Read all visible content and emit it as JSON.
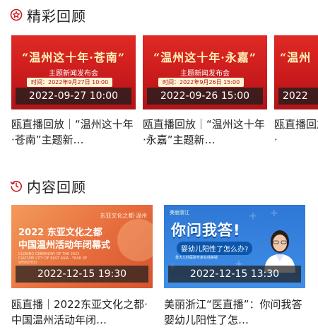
{
  "sections": {
    "highlights": {
      "title": "精彩回顾",
      "icon": "star-circle-icon"
    },
    "content": {
      "title": "内容回顾",
      "icon": "history-clock-icon"
    }
  },
  "highlights": [
    {
      "thumb_title": "“温州这十年·苍南”",
      "thumb_subtitle": "主题新闻发布会",
      "thumb_time": "时间：2022年9月27日 10:00",
      "date": "2022-09-27 10:00",
      "caption": "瓯直播回放｜“温州这十年·苍南”主题新…"
    },
    {
      "thumb_title": "“温州这十年·永嘉”",
      "thumb_subtitle": "主题新闻发布会",
      "thumb_time": "时间：2022年9月26日 15:00",
      "date": "2022-09-26 15:00",
      "caption": "瓯直播回放｜“温州这十年·永嘉”主题新…"
    },
    {
      "thumb_title": "“温州",
      "thumb_subtitle": "",
      "thumb_time": "",
      "date": "2022",
      "caption": "瓯直播回放｜“温州这十年·"
    }
  ],
  "content": [
    {
      "thumb_top": "东亚文化之都·温州",
      "thumb_line1": "2022 东亚文化之都",
      "thumb_line2": "中国温州活动年闭幕式",
      "thumb_en": "CLOSING CEREMONY OF THE 2022 CULTURE CITY OF EAST ASIA · YEAR OF WENZHOU",
      "date": "2022-12-15 19:30",
      "caption": "瓯直播｜2022东亚文化之都·中国温州活动年闭…"
    },
    {
      "thumb_logo": "美丽浙江",
      "thumb_title": "你问我答!",
      "thumb_question": "婴幼儿阳性了怎么办?",
      "thumb_sub": "重大儿科医院专家在线答疑",
      "date": "2022-12-15 13:30",
      "caption": "美丽浙江“医直播”：你问我答 婴幼儿阳性了怎…"
    }
  ],
  "colors": {
    "accent_red": "#c8161d",
    "thumb_red": "#d01f22",
    "overlay": "#1e1e1e"
  }
}
